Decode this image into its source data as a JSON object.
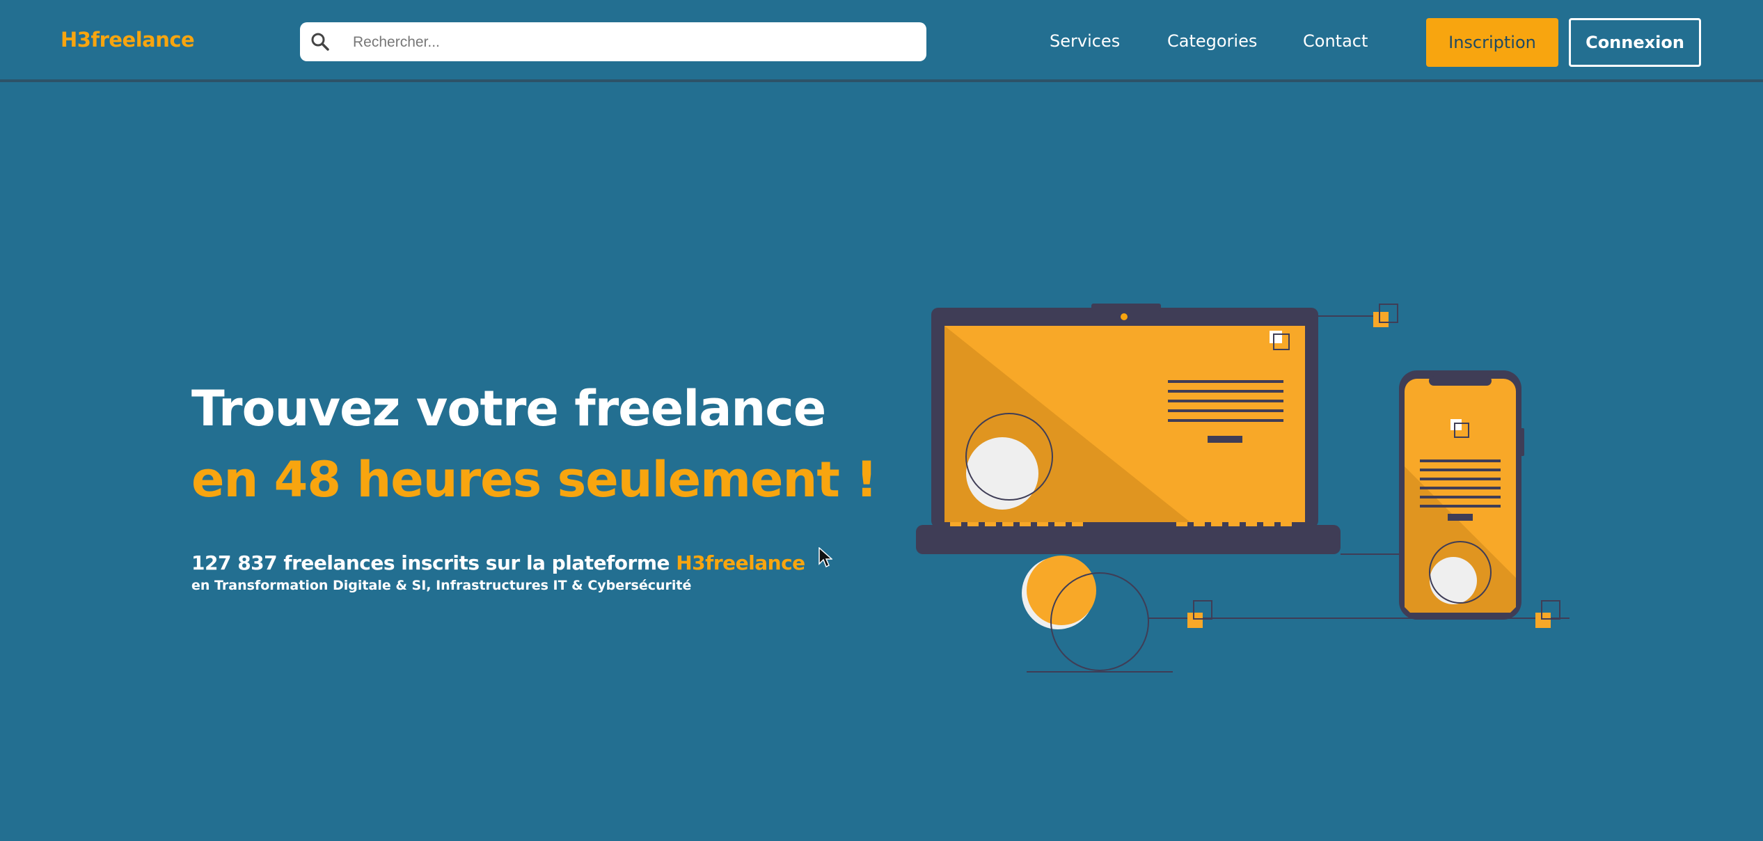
{
  "header": {
    "logo": "H3freelance",
    "search": {
      "placeholder": "Rechercher...",
      "value": ""
    },
    "nav": [
      {
        "label": "Services"
      },
      {
        "label": "Categories"
      },
      {
        "label": "Contact"
      }
    ],
    "signup_label": "Inscription",
    "login_label": "Connexion"
  },
  "hero": {
    "title_line1": "Trouvez votre freelance",
    "title_line2": "en 48 heures seulement !",
    "stats_prefix": "127 837 freelances inscrits sur la plateforme",
    "stats_brand": "H3freelance",
    "domains": "en Transformation Digitale & SI, Infrastructures IT & Cybersécurité"
  },
  "icons": {
    "search": "search-icon",
    "illustration": "devices-illustration",
    "cursor": "mouse-pointer-icon"
  },
  "colors": {
    "background": "#236f91",
    "accent": "#f8a50f",
    "dark": "#3f3d56",
    "text": "#ffffff"
  }
}
